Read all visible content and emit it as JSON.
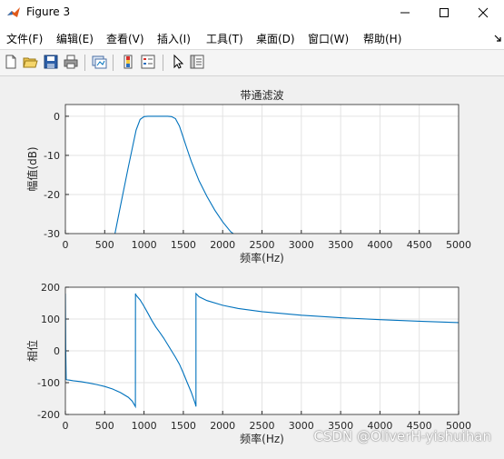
{
  "window": {
    "title": "Figure 3"
  },
  "menu": [
    "文件(F)",
    "编辑(E)",
    "查看(V)",
    "插入(I)",
    "工具(T)",
    "桌面(D)",
    "窗口(W)",
    "帮助(H)"
  ],
  "toolbar_icons": [
    "new-figure-icon",
    "open-icon",
    "save-icon",
    "print-icon",
    "link-plot-icon",
    "colorbar-icon",
    "legend-icon",
    "pointer-icon",
    "property-editor-icon"
  ],
  "watermark": "CSDN @OliverH-yishuihan",
  "chart_data": [
    {
      "type": "line",
      "title": "带通滤波",
      "xlabel": "频率(Hz)",
      "ylabel": "幅值(dB)",
      "xlim": [
        0,
        5000
      ],
      "ylim": [
        -30,
        3
      ],
      "xticks": [
        "0",
        "500",
        "1000",
        "1500",
        "2000",
        "2500",
        "3000",
        "3500",
        "4000",
        "4500",
        "5000"
      ],
      "yticks": [
        "0",
        "-10",
        "-20",
        "-30"
      ],
      "grid": true,
      "series": [
        {
          "color": "#0072BD",
          "x": [
            630,
            700,
            800,
            900,
            950,
            1000,
            1050,
            1100,
            1200,
            1300,
            1350,
            1400,
            1450,
            1500,
            1550,
            1600,
            1700,
            1800,
            1900,
            2000,
            2100,
            2200
          ],
          "y": [
            -30,
            -23,
            -13,
            -3.5,
            -0.8,
            -0.1,
            0,
            0,
            0,
            0,
            -0.1,
            -0.6,
            -2.5,
            -5.5,
            -8.5,
            -11.5,
            -16.5,
            -20.5,
            -24,
            -27,
            -29.5,
            -31
          ]
        }
      ]
    },
    {
      "type": "line",
      "title": "",
      "xlabel": "频率(Hz)",
      "ylabel": "相位",
      "xlim": [
        0,
        5000
      ],
      "ylim": [
        -200,
        200
      ],
      "xticks": [
        "0",
        "500",
        "1000",
        "1500",
        "2000",
        "2500",
        "3000",
        "3500",
        "4000",
        "4500",
        "5000"
      ],
      "yticks": [
        "200",
        "100",
        "0",
        "-100",
        "-200"
      ],
      "grid": true,
      "series": [
        {
          "color": "#0072BD",
          "x": [
            0,
            5,
            10,
            20,
            50,
            100,
            200,
            300,
            400,
            500,
            600,
            700,
            800,
            850,
            890,
            891,
            900,
            950,
            1000,
            1050,
            1100,
            1150,
            1200,
            1250,
            1300,
            1350,
            1400,
            1450,
            1500,
            1550,
            1600,
            1650,
            1660,
            1661,
            1700,
            1800,
            2000,
            2200,
            2500,
            3000,
            3500,
            4000,
            4500,
            5000
          ],
          "y": [
            180,
            0,
            -90,
            -91,
            -92,
            -94,
            -97,
            -101,
            -106,
            -112,
            -120,
            -131,
            -146,
            -158,
            -175,
            180,
            175,
            160,
            140,
            118,
            95,
            75,
            58,
            40,
            20,
            0,
            -20,
            -42,
            -70,
            -100,
            -130,
            -165,
            -175,
            180,
            170,
            158,
            143,
            133,
            123,
            112,
            104,
            98,
            93,
            89
          ]
        }
      ]
    }
  ]
}
